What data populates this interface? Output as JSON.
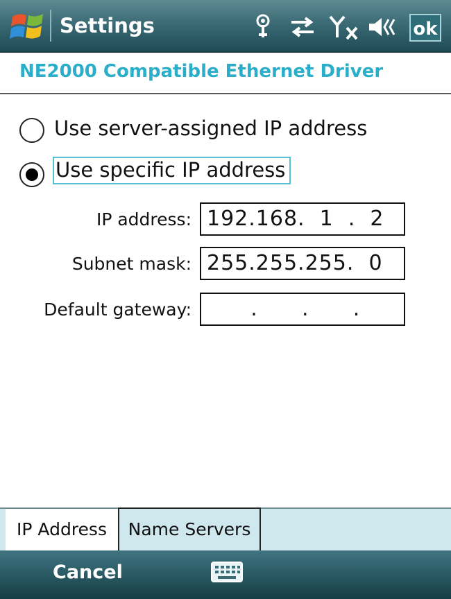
{
  "titlebar": {
    "title": "Settings",
    "ok_label": "ok",
    "icons": [
      "start-flag-icon",
      "signal-antenna-icon",
      "connectivity-arrows-icon",
      "no-signal-icon",
      "volume-icon"
    ]
  },
  "subheader": {
    "title": "NE2000 Compatible Ethernet Driver"
  },
  "radios": [
    {
      "label": "Use server-assigned IP address",
      "selected": false
    },
    {
      "label": "Use specific IP address",
      "selected": true
    }
  ],
  "fields": {
    "ip_address": {
      "label": "IP address:",
      "value": "192.168.  1  .  2"
    },
    "subnet_mask": {
      "label": "Subnet mask:",
      "value": "255.255.255.  0"
    },
    "default_gateway": {
      "label": "Default gateway:",
      "value": "      .      .      ."
    }
  },
  "tabs": [
    {
      "label": "IP Address",
      "active": true
    },
    {
      "label": "Name Servers",
      "active": false
    }
  ],
  "softkeys": {
    "left_label": "Cancel",
    "center_icon": "keyboard-icon"
  },
  "colors": {
    "accent": "#2aaec9",
    "titlebar": "#3b6b75",
    "tabstrip": "#cfe8ee"
  }
}
